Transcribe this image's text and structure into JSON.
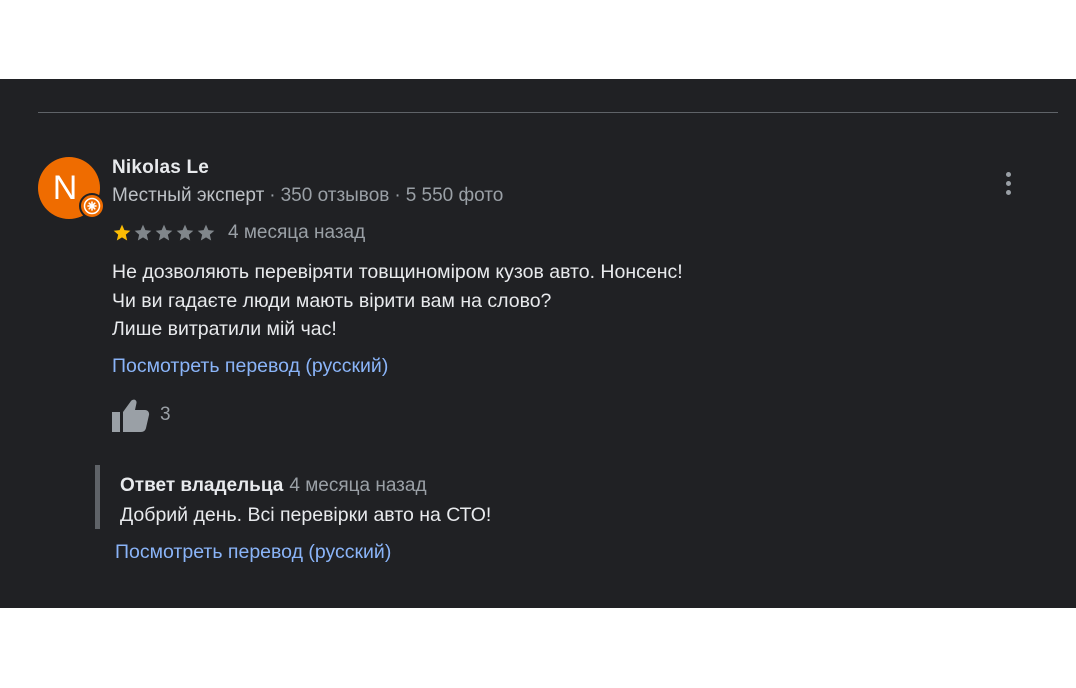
{
  "review": {
    "author": {
      "avatar_letter": "N",
      "avatar_color": "#ef6c00",
      "badge_icon": "local-guide-star-icon",
      "name": "Nikolas Le",
      "role": "Местный эксперт",
      "separator": "·",
      "reviews_count": "350 отзывов",
      "photos_count": "5 550 фото"
    },
    "rating": {
      "stars": 1,
      "max_stars": 5,
      "filled_color": "#fbbc04",
      "empty_color": "#80868b"
    },
    "date": "4 месяца назад",
    "text_lines": [
      "Не дозволяють перевіряти товщиноміром кузов авто. Нонсенс!",
      "Чи ви гадаєте люди мають вірити вам на слово?",
      "Лише витратили мій час!"
    ],
    "translate_label": "Посмотреть перевод (русский)",
    "likes": {
      "icon": "thumbs-up-icon",
      "count": "3"
    },
    "more_icon": "more-vert-icon"
  },
  "owner_reply": {
    "label": "Ответ владельца",
    "date": "4 месяца назад",
    "text": "Добрий день. Всі перевірки авто на СТО!",
    "translate_label": "Посмотреть перевод (русский)"
  },
  "colors": {
    "background": "#202124",
    "primary_text": "#e8eaed",
    "secondary_text": "#9aa0a6",
    "link": "#8ab4f8"
  }
}
